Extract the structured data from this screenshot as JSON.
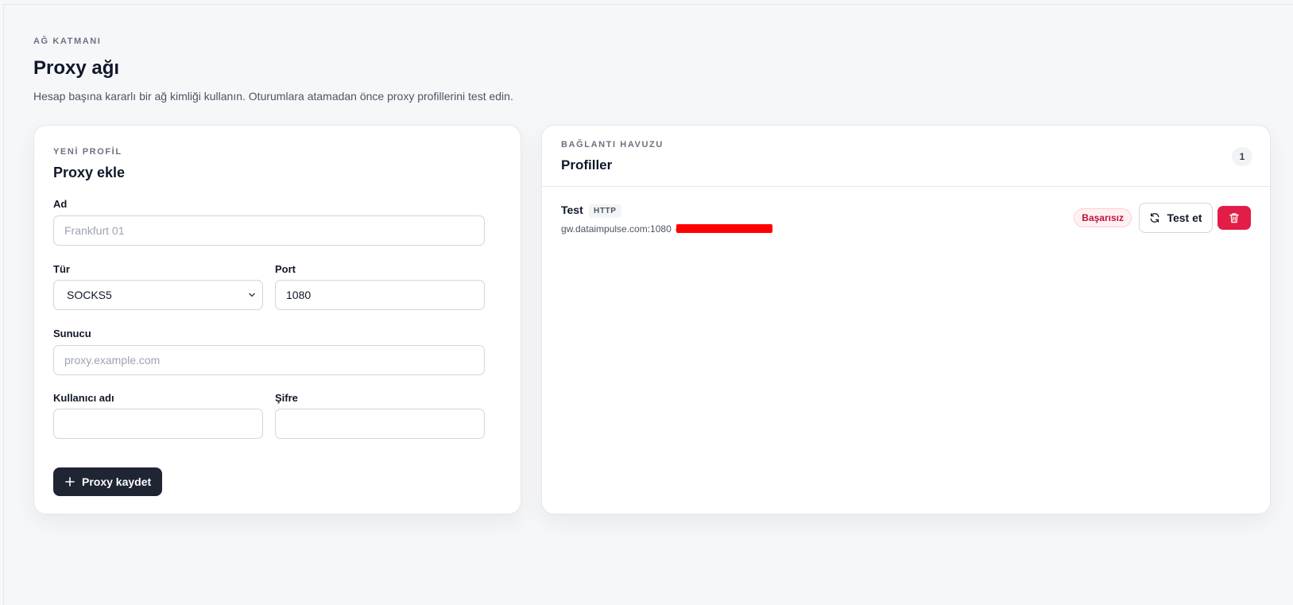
{
  "page": {
    "eyebrow": "AĞ KATMANI",
    "title": "Proxy ağı",
    "description": "Hesap başına kararlı bir ağ kimliği kullanın. Oturumlara atamadan önce proxy profillerini test edin."
  },
  "new_profile": {
    "eyebrow": "YENİ PROFİL",
    "title": "Proxy ekle",
    "name_label": "Ad",
    "name_placeholder": "Frankfurt 01",
    "name_value": "",
    "type_label": "Tür",
    "type_selected": "SOCKS5",
    "port_label": "Port",
    "port_value": "1080",
    "host_label": "Sunucu",
    "host_placeholder": "proxy.example.com",
    "host_value": "",
    "username_label": "Kullanıcı adı",
    "username_value": "",
    "password_label": "Şifre",
    "password_value": "",
    "save_label": "Proxy kaydet"
  },
  "pool": {
    "eyebrow": "BAĞLANTI HAVUZU",
    "title": "Profiller",
    "count": "1",
    "profiles": [
      {
        "name": "Test",
        "type": "HTTP",
        "host": "gw.dataimpulse.com:1080 ·",
        "status": "Başarısız",
        "test_label": "Test et"
      }
    ]
  },
  "icons": {
    "save": "plus-icon",
    "test": "refresh-icon",
    "delete": "trash-icon",
    "select": "chevron-down-icon"
  },
  "colors": {
    "primary_button": "#1f2533",
    "danger": "#e11d48",
    "failed_badge_text": "#be123c",
    "redaction": "#ff0000"
  }
}
